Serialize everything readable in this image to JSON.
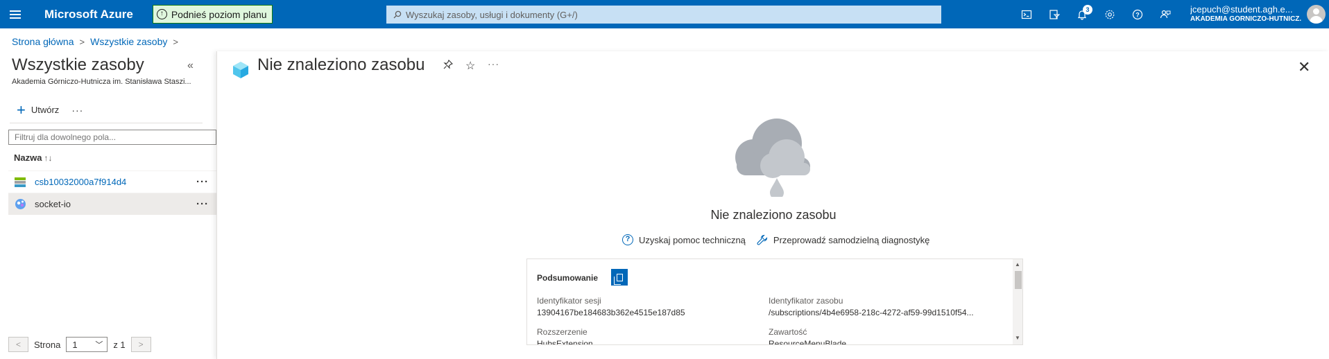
{
  "topbar": {
    "brand": "Microsoft Azure",
    "upgrade_label": "Podnieś poziom planu",
    "search_placeholder": "Wyszukaj zasoby, usługi i dokumenty (G+/)",
    "notifications_count": "3",
    "account_email": "jcepuch@student.agh.e...",
    "account_org": "AKADEMIA GÓRNICZO-HUTNICZ..."
  },
  "breadcrumb": {
    "home": "Strona główna",
    "current": "Wszystkie zasoby"
  },
  "left_blade": {
    "title": "Wszystkie zasoby",
    "subtitle": "Akademia Górniczo-Hutnicza im. Stanisława Staszi...",
    "create_label": "Utwórz",
    "filter_placeholder": "Filtruj dla dowolnego pola...",
    "column_name": "Nazwa",
    "sort_icon": "↑↓",
    "rows": [
      {
        "name": "csb10032000a7f914d4",
        "icon": "storage-account-icon"
      },
      {
        "name": "socket-io",
        "icon": "web-pubsub-icon"
      }
    ],
    "pager": {
      "prev": "<",
      "page_label": "Strona",
      "page_value": "1",
      "of_label": "z 1",
      "next": ">"
    }
  },
  "right_blade": {
    "title": "Nie znaleziono zasobu",
    "message": "Nie znaleziono zasobu",
    "help_link": "Uzyskaj pomoc techniczną",
    "diagnose_link": "Przeprowadź samodzielną diagnostykę",
    "summary": {
      "title": "Podsumowanie",
      "session_id_label": "Identyfikator sesji",
      "session_id_value": "13904167be184683b362e4515e187d85",
      "resource_id_label": "Identyfikator zasobu",
      "resource_id_value": "/subscriptions/4b4e6958-218c-4272-af59-99d1510f54...",
      "extension_label": "Rozszerzenie",
      "extension_value": "HubsExtension",
      "content_label": "Zawartość",
      "content_value": "ResourceMenuBlade"
    }
  },
  "colors": {
    "topbar_bg": "#0067b8",
    "accent": "#0067b8",
    "upgrade_bg": "#dff6dd"
  }
}
